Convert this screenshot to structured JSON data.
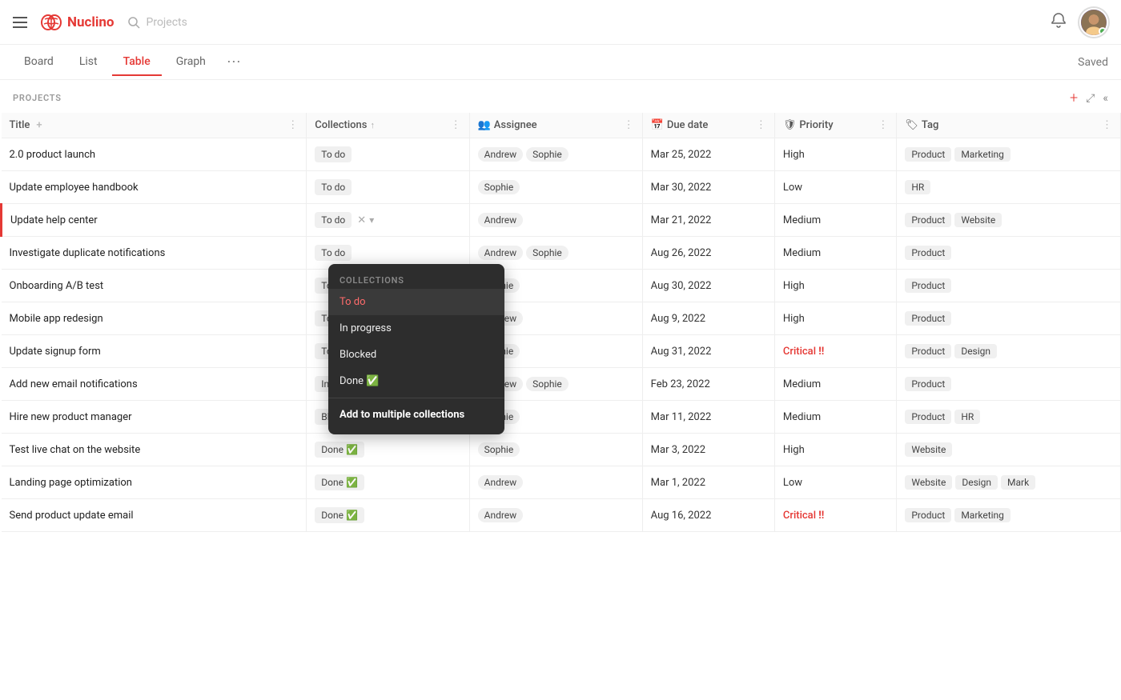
{
  "app": {
    "name": "Nuclino",
    "search_placeholder": "Projects"
  },
  "nav_tabs": [
    "Board",
    "List",
    "Table",
    "Graph"
  ],
  "active_tab": "Table",
  "saved_label": "Saved",
  "projects_label": "PROJECTS",
  "table": {
    "columns": [
      {
        "id": "title",
        "label": "Title",
        "icon": ""
      },
      {
        "id": "collections",
        "label": "Collections",
        "icon": ""
      },
      {
        "id": "assignee",
        "label": "Assignee",
        "icon": "👥"
      },
      {
        "id": "due_date",
        "label": "Due date",
        "icon": "📅"
      },
      {
        "id": "priority",
        "label": "Priority",
        "icon": "🛡"
      },
      {
        "id": "tag",
        "label": "Tag",
        "icon": "🏷"
      }
    ],
    "rows": [
      {
        "title": "2.0 product launch",
        "collection": "To do",
        "collection_done": false,
        "assignees": [
          "Andrew",
          "Sophie"
        ],
        "due_date": "Mar 25, 2022",
        "priority": "High",
        "priority_critical": false,
        "tags": [
          "Product",
          "Marketing"
        ],
        "active": false
      },
      {
        "title": "Update employee handbook",
        "collection": "To do",
        "collection_done": false,
        "assignees": [
          "Sophie"
        ],
        "due_date": "Mar 30, 2022",
        "priority": "Low",
        "priority_critical": false,
        "tags": [
          "HR"
        ],
        "active": false
      },
      {
        "title": "Update help center",
        "collection": "To do",
        "collection_done": false,
        "assignees": [
          "Andrew"
        ],
        "due_date": "Mar 21, 2022",
        "priority": "Medium",
        "priority_critical": false,
        "tags": [
          "Product",
          "Website"
        ],
        "active": true,
        "dropdown_open": true
      },
      {
        "title": "Investigate duplicate notifications",
        "collection": "To do",
        "collection_done": false,
        "assignees": [
          "Andrew",
          "Sophie"
        ],
        "due_date": "Aug 26, 2022",
        "priority": "Medium",
        "priority_critical": false,
        "tags": [
          "Product"
        ],
        "active": false
      },
      {
        "title": "Onboarding A/B test",
        "collection": "To do",
        "collection_done": false,
        "assignees": [
          "Sophie"
        ],
        "due_date": "Aug 30, 2022",
        "priority": "High",
        "priority_critical": false,
        "tags": [
          "Product"
        ],
        "active": false
      },
      {
        "title": "Mobile app redesign",
        "collection": "To do",
        "collection_done": false,
        "assignees": [
          "Andrew"
        ],
        "due_date": "Aug 9, 2022",
        "priority": "High",
        "priority_critical": false,
        "tags": [
          "Product"
        ],
        "active": false
      },
      {
        "title": "Update signup form",
        "collection": "To do",
        "collection_done": false,
        "assignees": [
          "Sophie"
        ],
        "due_date": "Aug 31, 2022",
        "priority": "Critical",
        "priority_critical": true,
        "tags": [
          "Product",
          "Design"
        ],
        "active": false
      },
      {
        "title": "Add new email notifications",
        "collection": "In progress",
        "collection_done": false,
        "assignees": [
          "Andrew",
          "Sophie"
        ],
        "due_date": "Feb 23, 2022",
        "priority": "Medium",
        "priority_critical": false,
        "tags": [
          "Product"
        ],
        "active": false
      },
      {
        "title": "Hire new product manager",
        "collection": "Blocked",
        "collection_done": false,
        "assignees": [
          "Sophie"
        ],
        "due_date": "Mar 11, 2022",
        "priority": "Medium",
        "priority_critical": false,
        "tags": [
          "Product",
          "HR"
        ],
        "active": false
      },
      {
        "title": "Test live chat on the website",
        "collection": "Done",
        "collection_done": true,
        "assignees": [
          "Sophie"
        ],
        "due_date": "Mar 3, 2022",
        "priority": "High",
        "priority_critical": false,
        "tags": [
          "Website"
        ],
        "active": false
      },
      {
        "title": "Landing page optimization",
        "collection": "Done",
        "collection_done": true,
        "assignees": [
          "Andrew"
        ],
        "due_date": "Mar 1, 2022",
        "priority": "Low",
        "priority_critical": false,
        "tags": [
          "Website",
          "Design",
          "Mark"
        ],
        "active": false
      },
      {
        "title": "Send product update email",
        "collection": "Done",
        "collection_done": true,
        "assignees": [
          "Andrew"
        ],
        "due_date": "Aug 16, 2022",
        "priority": "Critical",
        "priority_critical": true,
        "tags": [
          "Product",
          "Marketing"
        ],
        "active": false
      }
    ],
    "dropdown": {
      "section_label": "COLLECTIONS",
      "items": [
        {
          "label": "To do",
          "active": true,
          "check": false,
          "bold": false
        },
        {
          "label": "In progress",
          "active": false,
          "check": false,
          "bold": false
        },
        {
          "label": "Blocked",
          "active": false,
          "check": false,
          "bold": false
        },
        {
          "label": "Done ✅",
          "active": false,
          "check": true,
          "bold": false
        },
        {
          "label": "Add to multiple collections",
          "active": false,
          "check": false,
          "bold": true
        }
      ]
    }
  }
}
